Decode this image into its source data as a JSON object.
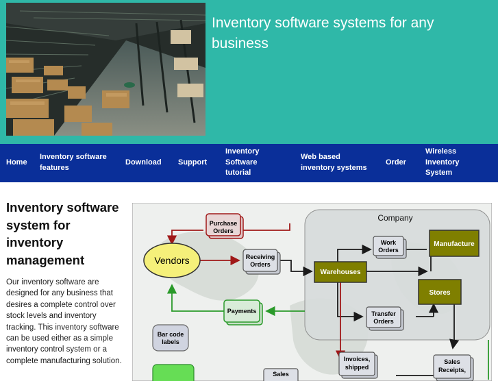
{
  "header": {
    "title": "Inventory software systems for any business"
  },
  "nav": {
    "home": "Home",
    "features": "Inventory software features",
    "download": "Download",
    "support": "Support",
    "tutorial": "Inventory Software tutorial",
    "web": "Web based inventory systems",
    "order": "Order",
    "wireless": "Wireless Inventory System"
  },
  "main": {
    "heading": "Inventory software system for inventory management",
    "paragraph": "Our inventory software are designed for any business that desires a complete control over stock levels and inventory tracking. This inventory software can be used either as a simple inventory control system or a complete manufacturing solution."
  },
  "diagram": {
    "company": "Company",
    "vendors": "Vendors",
    "purchase_orders": [
      "Purchase",
      "Orders"
    ],
    "receiving_orders": [
      "Receiving",
      "Orders"
    ],
    "payments": "Payments",
    "barcode": [
      "Bar code",
      "labels"
    ],
    "work_orders": [
      "Work",
      "Orders"
    ],
    "manufacture": "Manufacture",
    "warehouses": "Warehouses",
    "stores": "Stores",
    "transfer_orders": [
      "Transfer",
      "Orders"
    ],
    "invoices": [
      "Invoices,",
      "shipped"
    ],
    "sales_receipts": [
      "Sales",
      "Receipts,"
    ],
    "sales_cut": "Sales"
  },
  "colors": {
    "header_bg": "#2fb8a8",
    "nav_bg": "#0a2f99",
    "olive": "#7f7f00",
    "vendors_fill": "#f5f07a",
    "arrow_red": "#a01818",
    "arrow_green": "#2a9a2a"
  }
}
